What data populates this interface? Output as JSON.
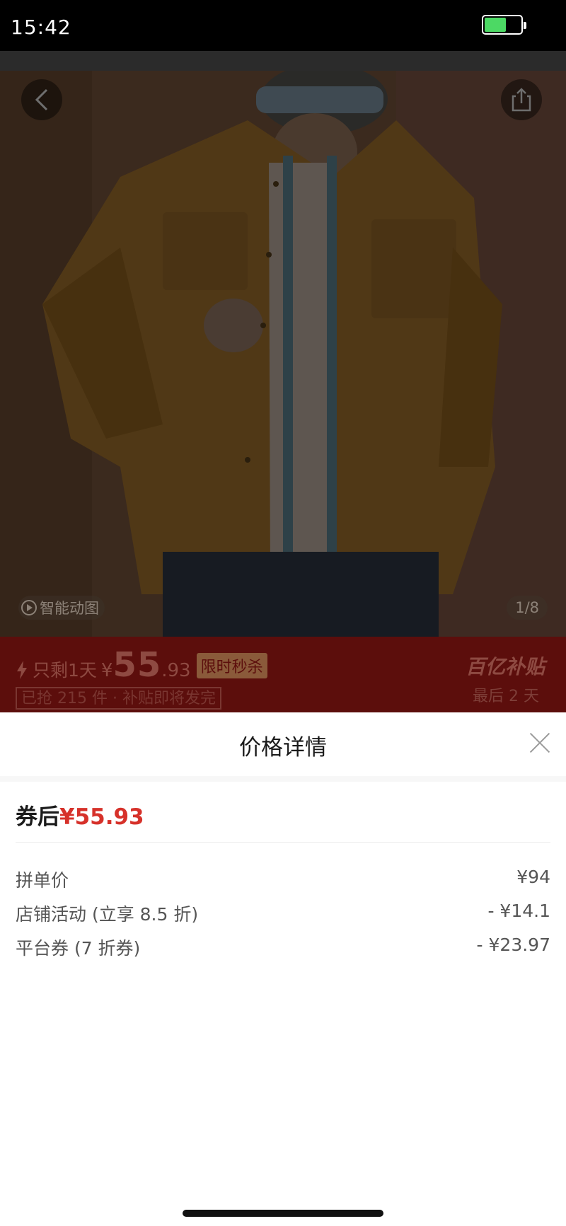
{
  "status_bar": {
    "time": "15:42",
    "battery_level": 0.6
  },
  "product": {
    "motion_label": "智能动图",
    "page_indicator": "1/8"
  },
  "promo": {
    "remaining_text": "只剩1天",
    "currency": "¥",
    "price_integer": "55",
    "price_decimal": ".93",
    "flash_tag": "限时秒杀",
    "sold_info": "已抢 215 件 · 补贴即将发完",
    "subsidy_logo": "百亿补贴",
    "subsidy_days": "最后 2 天"
  },
  "sheet": {
    "title": "价格详情",
    "final_label": "券后",
    "final_amount": "¥55.93",
    "rows": [
      {
        "label": "拼单价",
        "value": "¥94"
      },
      {
        "label": "店铺活动 (立享 8.5 折)",
        "value": "- ¥14.1"
      },
      {
        "label": "平台券 (7 折券)",
        "value": "- ¥23.97"
      }
    ]
  },
  "colors": {
    "accent_red": "#d6312a",
    "battery_green": "#4cd964"
  }
}
